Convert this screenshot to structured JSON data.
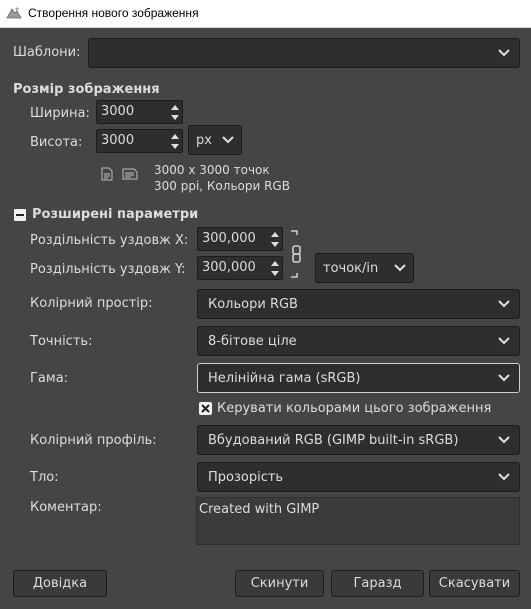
{
  "window": {
    "title": "Створення нового зображення"
  },
  "templates": {
    "label": "Шаблони:",
    "value": ""
  },
  "image_size": {
    "heading": "Розмір зображення",
    "width_label": "Ширина:",
    "width_value": "3000",
    "height_label": "Висота:",
    "height_value": "3000",
    "unit": "px",
    "info_line1": "3000 x 3000 точок",
    "info_line2": "300 ppi, Кольори RGB"
  },
  "advanced": {
    "heading": "Розширені параметри",
    "xres_label": "Роздільність уздовж X:",
    "xres_value": "300,000",
    "yres_label": "Роздільність уздовж Y:",
    "yres_value": "300,000",
    "res_unit": "точок/in",
    "colorspace_label": "Колірний простір:",
    "colorspace_value": "Кольори RGB",
    "precision_label": "Точність:",
    "precision_value": "8-бітове ціле",
    "gamma_label": "Гама:",
    "gamma_value": "Нелінійна гама (sRGB)",
    "color_manage_label": "Керувати кольорами цього зображення",
    "color_manage_checked": true,
    "profile_label": "Колірний профіль:",
    "profile_value": "Вбудований RGB (GIMP built-in sRGB)",
    "fill_label": "Тло:",
    "fill_value": "Прозорість",
    "comment_label": "Коментар:",
    "comment_value": "Created with GIMP"
  },
  "buttons": {
    "help": "Довідка",
    "reset": "Скинути",
    "ok": "Гаразд",
    "cancel": "Скасувати"
  }
}
